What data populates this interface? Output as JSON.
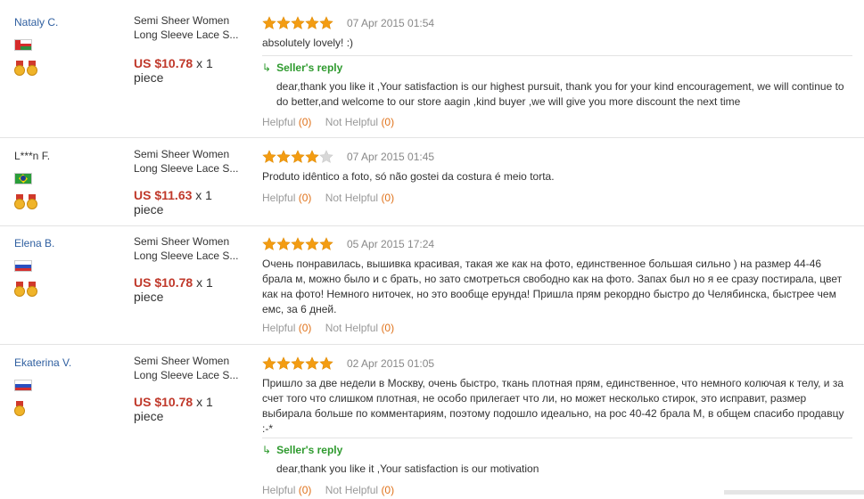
{
  "reviews": [
    {
      "buyer": "Nataly C.",
      "flag": "oman",
      "medals": 2,
      "product": "Semi Sheer Women Long Sleeve Lace S...",
      "price": "US $10.78",
      "qty": "x 1",
      "unit": "piece",
      "rating": 5,
      "date": "07 Apr 2015 01:54",
      "text": "absolutely lovely! :)",
      "reply_label": "Seller's reply",
      "reply": "dear,thank you like it ,Your satisfaction is our highest pursuit, thank you for your kind encouragement, we will continue to do better,and welcome to our store aagin ,kind buyer ,we will give you more discount the next time",
      "helpful_label": "Helpful",
      "helpful_count": "(0)",
      "not_helpful_label": "Not Helpful",
      "not_helpful_count": "(0)"
    },
    {
      "buyer": "L***n F.",
      "flag": "brazil",
      "medals": 2,
      "product": "Semi Sheer Women Long Sleeve Lace S...",
      "price": "US $11.63",
      "qty": "x 1",
      "unit": "piece",
      "rating": 4,
      "date": "07 Apr 2015 01:45",
      "text": "Produto idêntico a foto, só não gostei da costura é meio torta.",
      "helpful_label": "Helpful",
      "helpful_count": "(0)",
      "not_helpful_label": "Not Helpful",
      "not_helpful_count": "(0)"
    },
    {
      "buyer": "Elena B.",
      "flag": "russia",
      "medals": 2,
      "product": "Semi Sheer Women Long Sleeve Lace S...",
      "price": "US $10.78",
      "qty": "x 1",
      "unit": "piece",
      "rating": 5,
      "date": "05 Apr 2015 17:24",
      "text": "Очень понравилась, вышивка красивая, такая же как на фото, единственное большая сильно ) на размер 44-46 брала м, можно было и с брать, но зато смотреться свободно как на фото. Запах был но я ее сразу постирала, цвет как на фото! Немного ниточек, но это вообще ерунда! Пришла прям рекордно быстро до Челябинска, быстрее чем емс, за 6 дней.",
      "helpful_label": "Helpful",
      "helpful_count": "(0)",
      "not_helpful_label": "Not Helpful",
      "not_helpful_count": "(0)"
    },
    {
      "buyer": "Ekaterina V.",
      "flag": "russia",
      "medals": 1,
      "product": "Semi Sheer Women Long Sleeve Lace S...",
      "price": "US $10.78",
      "qty": "x 1",
      "unit": "piece",
      "rating": 5,
      "date": "02 Apr 2015 01:05",
      "text": "Пришло за две недели в Москву, очень быстро, ткань плотная прям, единственное, что немного колючая к телу, и за счет того что слишком плотная, не особо прилегает что ли, но может несколько стирок, это исправит, размер выбирала больше по комментариям, поэтому подошло идеально, на рос 40-42 брала М, в общем спасибо продавцу :-*",
      "reply_label": "Seller's reply",
      "reply": "dear,thank you like it ,Your satisfaction is our motivation",
      "helpful_label": "Helpful",
      "helpful_count": "(0)",
      "not_helpful_label": "Not Helpful",
      "not_helpful_count": "(0)"
    }
  ],
  "colors": {
    "buyer_link": "#2f5fa0",
    "price": "#c0392b",
    "star": "#f39c12",
    "reply": "#2e9a2e",
    "count": "#e0731c"
  }
}
